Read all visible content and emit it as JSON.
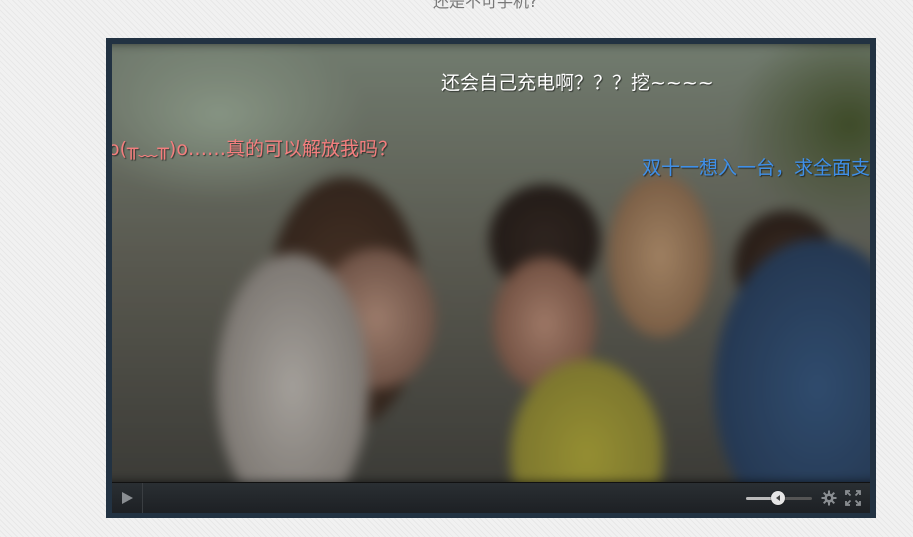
{
  "page": {
    "top_caption": "还是不可手机?"
  },
  "player": {
    "danmaku": [
      {
        "text": "还会自己充电啊？？？挖~~~~",
        "color": "#ffffff"
      },
      {
        "text": "o(╥﹏╥)o……真的可以解放我吗？",
        "color": "#f47e7e"
      },
      {
        "text": "双十一想入一台，求全面支",
        "color": "#3f8fe8"
      }
    ],
    "controls": {
      "volume_level": 0.48,
      "icons": {
        "play": "play-icon",
        "volume": "volume-slider",
        "settings": "gear-icon",
        "fullscreen": "fullscreen-icon"
      }
    }
  }
}
